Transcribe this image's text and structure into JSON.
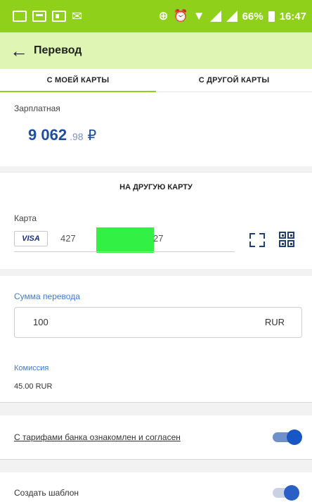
{
  "status_bar": {
    "battery": "66%",
    "time": "16:47",
    "glyph_usb": "⊕",
    "glyph_alarm": "⏰",
    "glyph_wifi": "▼"
  },
  "toolbar": {
    "back_icon": "←",
    "title": "Перевод"
  },
  "tabs": [
    {
      "label": "С МОЕЙ КАРТЫ",
      "active": true
    },
    {
      "label": "С ДРУГОЙ КАРТЫ",
      "active": false
    }
  ],
  "account": {
    "name": "Зарплатная",
    "amount_int": "9 062",
    "amount_frac": ".98",
    "currency_symbol": "₽"
  },
  "section_title": "НА ДРУГУЮ КАРТУ",
  "card": {
    "label": "Карта",
    "brand": "VISA",
    "number_start": "427",
    "number_end": "27"
  },
  "amount": {
    "label": "Сумма перевода",
    "value": "100",
    "currency": "RUR"
  },
  "commission": {
    "label": "Комиссия",
    "value": "45.00 RUR"
  },
  "terms": {
    "label": "С тарифами банка ознакомлен и согласен",
    "enabled": true
  },
  "template": {
    "label": "Создать шаблон",
    "enabled": false
  },
  "colors": {
    "status_bar": "#8fd11a",
    "toolbar": "#dff5b4",
    "amount_blue": "#1e4e9c",
    "link_blue": "#3c7bd1",
    "toggle_blue": "#1657c5",
    "mask_green": "#33f045"
  }
}
